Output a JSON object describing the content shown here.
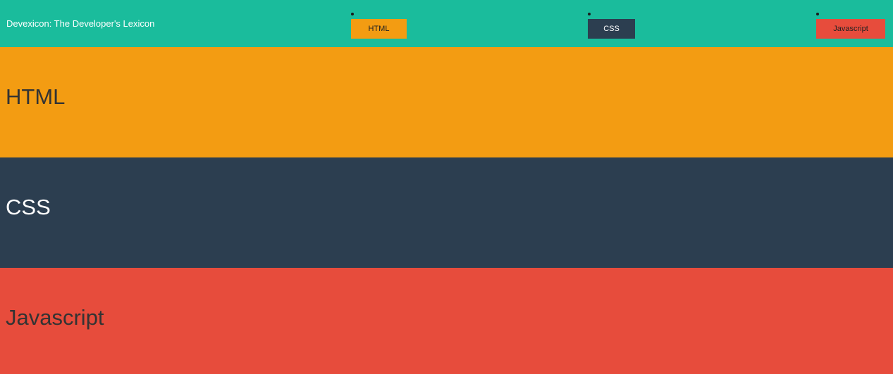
{
  "header": {
    "brand": "Devexicon: The Developer's Lexicon",
    "background": "#1abc9c",
    "nav": [
      {
        "label": "HTML",
        "background": "#f39c12",
        "color": "#222222"
      },
      {
        "label": "CSS",
        "background": "#2c3e50",
        "color": "#ffffff"
      },
      {
        "label": "Javascript",
        "background": "#e74c3c",
        "color": "#222222"
      }
    ]
  },
  "sections": [
    {
      "title": "HTML",
      "background": "#f39c12",
      "color": "#333333"
    },
    {
      "title": "CSS",
      "background": "#2c3e50",
      "color": "#ffffff"
    },
    {
      "title": "Javascript",
      "background": "#e74c3c",
      "color": "#333333"
    }
  ]
}
